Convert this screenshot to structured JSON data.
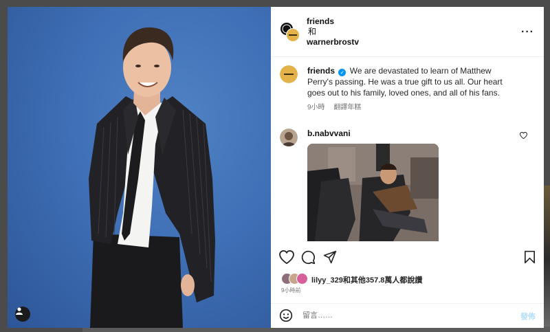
{
  "post": {
    "authors": [
      "friends",
      "warnerbrostv"
    ],
    "and_label": "和",
    "more_label": "···"
  },
  "caption": {
    "username": "friends",
    "verified": true,
    "text": "We are devastated to learn of Matthew Perry's passing. He was a true gift to us all. Our heart goes out to his family, loved ones, and all of his fans.",
    "time": "9小時",
    "translate_label": "翻譯年糕"
  },
  "comment": {
    "username": "b.nabvvani",
    "attachment": "gif"
  },
  "likes": {
    "text": "lilyy_329和其他357.8萬人都說讚"
  },
  "timestamp": "9小時前",
  "add_comment": {
    "placeholder": "留言……",
    "post_label": "發佈"
  },
  "icons": [
    "heart-icon",
    "comment-icon",
    "share-icon",
    "bookmark-icon",
    "emoji-icon",
    "more-icon",
    "user-tag-icon",
    "verified-icon"
  ],
  "colors": {
    "accent": "#0095f6",
    "post_disabled": "#b2dffc",
    "photo_bg": "#3f6fb6"
  }
}
